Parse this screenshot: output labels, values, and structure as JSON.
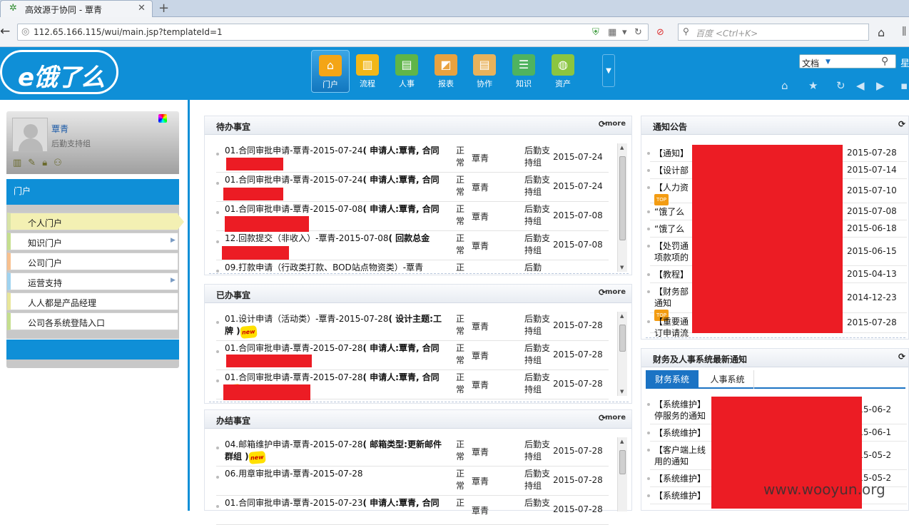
{
  "browser": {
    "tab_title": "高效源于协同 - 覃青",
    "url": "112.65.166.115/wui/main.jsp?templateId=1",
    "search_placeholder": "百度 <Ctrl+K>"
  },
  "brand": {
    "logo_text": "e饿了么",
    "accent": "#0f8fd7",
    "redact": "#ec1c24"
  },
  "nav": [
    {
      "label": "门户",
      "icon": "home-icon",
      "color": "#f4a516"
    },
    {
      "label": "流程",
      "icon": "chart-icon",
      "color": "#f2b719"
    },
    {
      "label": "人事",
      "icon": "people-icon",
      "color": "#5fb548"
    },
    {
      "label": "报表",
      "icon": "report-icon",
      "color": "#e9a23f"
    },
    {
      "label": "协作",
      "icon": "collab-icon",
      "color": "#e8b25b"
    },
    {
      "label": "知识",
      "icon": "knowledge-icon",
      "color": "#4fb35f"
    },
    {
      "label": "资产",
      "icon": "asset-icon",
      "color": "#8bc540"
    }
  ],
  "toolbar": {
    "doc_select": "文档",
    "star_label": "星"
  },
  "user": {
    "name": "覃青",
    "dept": "后勤支持组"
  },
  "left": {
    "portal_title": "门户",
    "menu": [
      {
        "label": "个人门户"
      },
      {
        "label": "知识门户"
      },
      {
        "label": "公司门户"
      },
      {
        "label": "运营支持"
      },
      {
        "label": "人人都是产品经理"
      },
      {
        "label": "公司各系统登陆入口"
      }
    ]
  },
  "panels": {
    "more": "more",
    "todo": {
      "title": "待办事宜",
      "rows": [
        {
          "title": "01.合同审批申请-覃青-2015-07-24",
          "bold": "( 申请人:覃青, 合同",
          "status": "正常",
          "person": "覃青",
          "dept": "后勤支持组",
          "date": "2015-07-24"
        },
        {
          "title": "01.合同审批申请-覃青-2015-07-24",
          "bold": "( 申请人:覃青, 合同",
          "status": "正常",
          "person": "覃青",
          "dept": "后勤支持组",
          "date": "2015-07-24"
        },
        {
          "title": "01.合同审批申请-覃青-2015-07-08",
          "bold": "( 申请人:覃青, 合同",
          "status": "正常",
          "person": "覃青",
          "dept": "后勤支持组",
          "date": "2015-07-08"
        },
        {
          "title": "12.回款提交（非收入）-覃青-2015-07-08",
          "bold": "( 回款总金",
          "status": "正常",
          "person": "覃青",
          "dept": "后勤支持组",
          "date": "2015-07-08"
        },
        {
          "title": "09.打款申请（行政类打款、BOD站点物资类）-覃青",
          "bold": "",
          "status": "正",
          "person": "",
          "dept": "后勤",
          "date": ""
        }
      ]
    },
    "done": {
      "title": "已办事宜",
      "rows": [
        {
          "title": "01.设计申请（活动类）-覃青-2015-07-28",
          "bold": "( 设计主题:工牌 )",
          "status": "正常",
          "person": "覃青",
          "dept": "后勤支持组",
          "date": "2015-07-28",
          "badge": "new"
        },
        {
          "title": "01.合同审批申请-覃青-2015-07-28",
          "bold": "( 申请人:覃青, 合同",
          "status": "正常",
          "person": "覃青",
          "dept": "后勤支持组",
          "date": "2015-07-28"
        },
        {
          "title": "01.合同审批申请-覃青-2015-07-28",
          "bold": "( 申请人:覃青, 合同",
          "status": "正常",
          "person": "覃青",
          "dept": "后勤支持组",
          "date": "2015-07-28",
          "badge": "new"
        }
      ]
    },
    "finished": {
      "title": "办结事宜",
      "rows": [
        {
          "title": "04.邮箱维护申请-覃青-2015-07-28",
          "bold": "( 邮箱类型:更新邮件群组 )",
          "status": "正常",
          "person": "覃青",
          "dept": "后勤支持组",
          "date": "2015-07-28",
          "badge": "new"
        },
        {
          "title": "06.用章审批申请-覃青-2015-07-28",
          "bold": "",
          "status": "正常",
          "person": "覃青",
          "dept": "后勤支持组",
          "date": "2015-07-28"
        },
        {
          "title": "01.合同审批申请-覃青-2015-07-23",
          "bold": "( 申请人:覃青, 合同",
          "status": "正",
          "person": "覃青",
          "dept": "后勤支",
          "date": "2015-07-28"
        }
      ]
    },
    "notice": {
      "title": "通知公告",
      "rows": [
        {
          "title": "【通知】",
          "date": "2015-07-28"
        },
        {
          "title": "【设计部",
          "date": "2015-07-14"
        },
        {
          "title": "【人力资",
          "date": "2015-07-10",
          "top": "TOP"
        },
        {
          "title": "“饿了么",
          "date": "2015-07-08"
        },
        {
          "title": "“饿了么",
          "date": "2015-06-18"
        },
        {
          "title": "【处罚通",
          "line2": "项款项的",
          "date": "2015-06-15"
        },
        {
          "title": "【教程】",
          "date": "2015-04-13"
        },
        {
          "title": "【财务部",
          "line2": "通知",
          "date": "2014-12-23",
          "top": "TOP"
        },
        {
          "title": "【重要通",
          "line2": "订申请流",
          "date": "2015-07-28"
        }
      ]
    },
    "finance": {
      "title": "财务及人事系统最新通知",
      "tabs": [
        "财务系统",
        "人事系统"
      ],
      "rows": [
        {
          "title": "【系统维护】",
          "line2": "停服务的通知",
          "date": "2015-06-2"
        },
        {
          "title": "【系统维护】",
          "date": "2015-06-1"
        },
        {
          "title": "【客户端上线",
          "line2": "用的通知",
          "date": "2015-05-2"
        },
        {
          "title": "【系统维护】",
          "date": "2015-05-2"
        },
        {
          "title": "【系统维护】",
          "date": ""
        }
      ]
    }
  },
  "watermark": "www.wooyun.org"
}
